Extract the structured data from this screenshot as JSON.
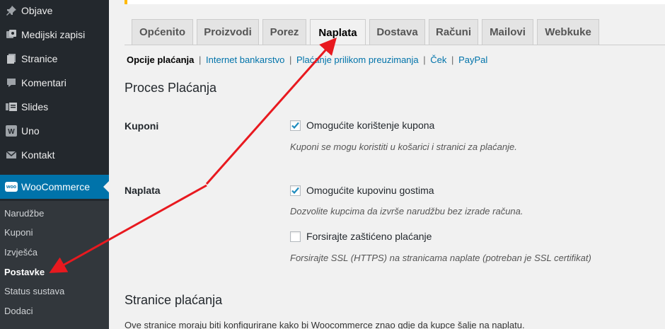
{
  "sidebar": {
    "items": [
      {
        "label": "Objave"
      },
      {
        "label": "Medijski zapisi"
      },
      {
        "label": "Stranice"
      },
      {
        "label": "Komentari"
      },
      {
        "label": "Slides"
      },
      {
        "label": "Uno"
      },
      {
        "label": "Kontakt"
      }
    ],
    "woocommerce": {
      "label": "WooCommerce",
      "badge": "woo"
    },
    "submenu": [
      {
        "label": "Narudžbe"
      },
      {
        "label": "Kuponi"
      },
      {
        "label": "Izvješća"
      },
      {
        "label": "Postavke"
      },
      {
        "label": "Status sustava"
      },
      {
        "label": "Dodaci"
      }
    ]
  },
  "tabs": [
    {
      "label": "Općenito"
    },
    {
      "label": "Proizvodi"
    },
    {
      "label": "Porez"
    },
    {
      "label": "Naplata"
    },
    {
      "label": "Dostava"
    },
    {
      "label": "Računi"
    },
    {
      "label": "Mailovi"
    },
    {
      "label": "Webkuke"
    }
  ],
  "subsections": [
    {
      "label": "Opcije plaćanja"
    },
    {
      "label": "Internet bankarstvo"
    },
    {
      "label": "Plaćanje prilikom preuzimanja"
    },
    {
      "label": "Ček"
    },
    {
      "label": "PayPal"
    }
  ],
  "process": {
    "title": "Proces Plaćanja",
    "kuponi_label": "Kuponi",
    "kuponi_option": "Omogućite korištenje kupona",
    "kuponi_desc": "Kuponi se mogu koristiti u košarici i stranici za plaćanje.",
    "naplata_label": "Naplata",
    "guest_option": "Omogućite kupovinu gostima",
    "guest_desc": "Dozvolite kupcima da izvrše narudžbu bez izrade računa.",
    "ssl_option": "Forsirajte zaštićeno plaćanje",
    "ssl_desc": "Forsirajte SSL (HTTPS) na stranicama naplate (potreban je SSL certifikat)"
  },
  "pages": {
    "title": "Stranice plaćanja",
    "intro": "Ove stranice moraju biti konfigurirane kako bi Woocommerce znao gdje da kupce šalje na naplatu."
  },
  "colors": {
    "accent": "#0073aa",
    "annotation": "#e8191f",
    "sidebar": "#23282d"
  }
}
